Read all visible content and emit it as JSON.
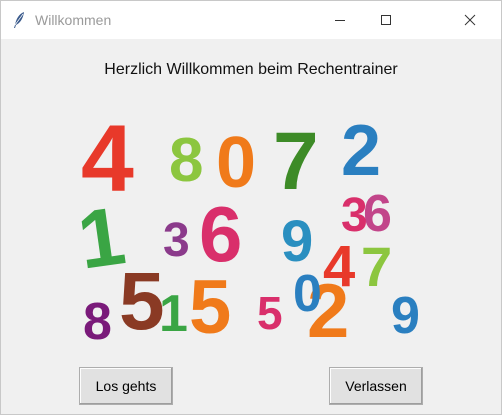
{
  "window": {
    "title": "Willkommen",
    "icon": "feather-icon"
  },
  "main": {
    "heading": "Herzlich Willkommen beim Rechentrainer",
    "illustration": {
      "digits": [
        "4",
        "8",
        "0",
        "7",
        "2",
        "1",
        "3",
        "6",
        "9",
        "6",
        "3",
        "5",
        "4",
        "8",
        "5",
        "1",
        "5",
        "2",
        "0",
        "7",
        "9"
      ]
    }
  },
  "buttons": {
    "start_label": "Los gehts",
    "quit_label": "Verlassen"
  }
}
